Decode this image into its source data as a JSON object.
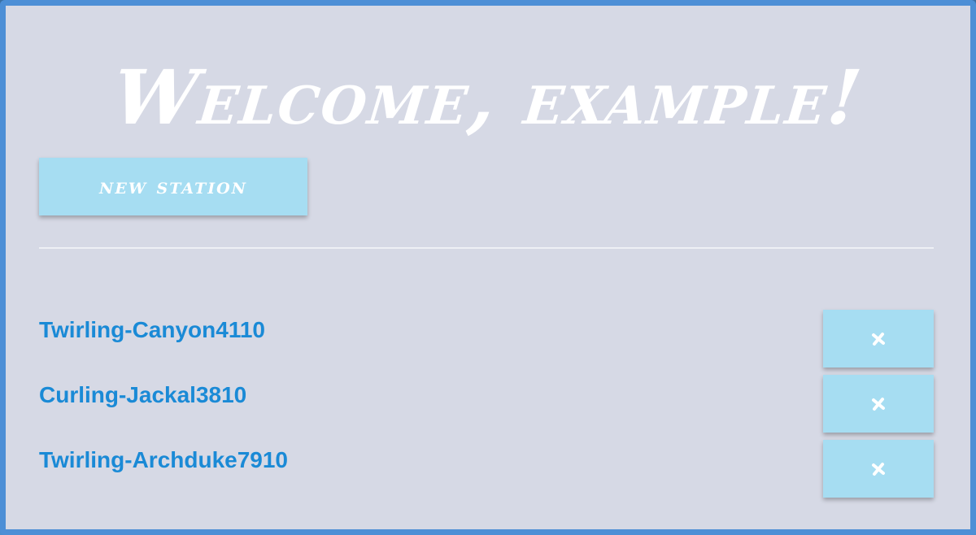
{
  "header": {
    "title": "Welcome, example!"
  },
  "actions": {
    "new_station_label": "new station"
  },
  "stations": [
    {
      "name": "Twirling-Canyon4110",
      "delete_icon": "close-icon"
    },
    {
      "name": "Curling-Jackal3810",
      "delete_icon": "close-icon"
    },
    {
      "name": "Twirling-Archduke7910",
      "delete_icon": "close-icon"
    }
  ],
  "colors": {
    "accent": "#4d8fd6",
    "background": "#d6d9e5",
    "button": "#a6ddf2",
    "link": "#1a8ad6",
    "title": "#ffffff"
  }
}
